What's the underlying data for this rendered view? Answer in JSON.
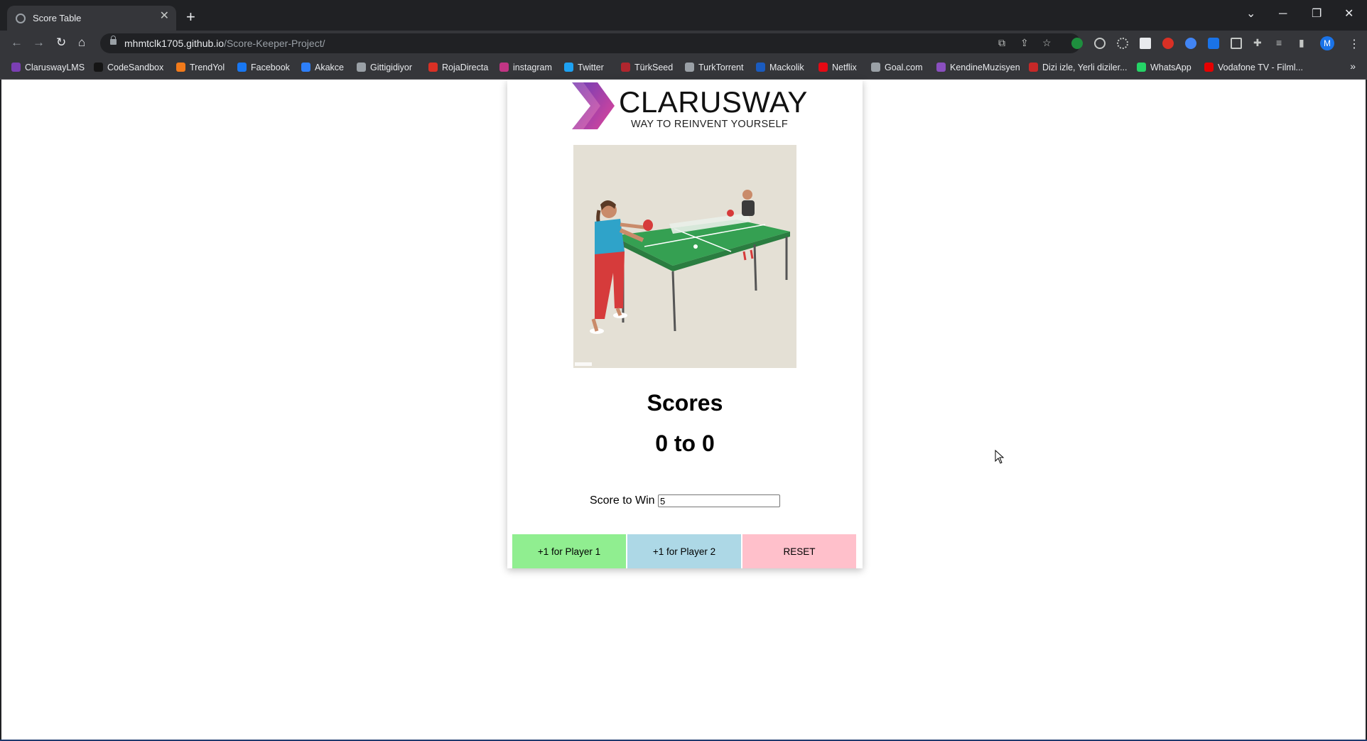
{
  "browser": {
    "tab_title": "Score Table",
    "url_host": "mhmtclk1705.github.io",
    "url_path": "/Score-Keeper-Project/",
    "profile_initial": "M"
  },
  "bookmarks": [
    {
      "label": "ClaruswayLMS",
      "color": "#7b3fb3"
    },
    {
      "label": "CodeSandbox",
      "color": "#151515"
    },
    {
      "label": "TrendYol",
      "color": "#f27a1a"
    },
    {
      "label": "Facebook",
      "color": "#1877f2"
    },
    {
      "label": "Akakce",
      "color": "#2d7ff9"
    },
    {
      "label": "Gittigidiyor",
      "color": "#9aa0a6"
    },
    {
      "label": "RojaDirecta",
      "color": "#d93025"
    },
    {
      "label": "instagram",
      "color": "#c13584"
    },
    {
      "label": "Twitter",
      "color": "#1da1f2"
    },
    {
      "label": "TürkSeed",
      "color": "#b0262e"
    },
    {
      "label": "TurkTorrent",
      "color": "#9aa0a6"
    },
    {
      "label": "Mackolik",
      "color": "#1a5bbf"
    },
    {
      "label": "Netflix",
      "color": "#e50914"
    },
    {
      "label": "Goal.com",
      "color": "#9aa0a6"
    },
    {
      "label": "KendineMuzisyen",
      "color": "#8a4fbf"
    },
    {
      "label": "Dizi izle, Yerli diziler...",
      "color": "#c62828"
    },
    {
      "label": "WhatsApp",
      "color": "#25d366"
    },
    {
      "label": "Vodafone TV - Filml...",
      "color": "#e60000"
    }
  ],
  "logo": {
    "title": "CLARUSWAY",
    "tagline": "WAY TO REINVENT YOURSELF",
    "gradient_start": "#7b3fb3",
    "gradient_end": "#e0459a"
  },
  "score": {
    "heading": "Scores",
    "player1": "0",
    "separator": "to",
    "player2": "0",
    "win_label": "Score to Win",
    "win_value": "5"
  },
  "buttons": {
    "player1": "+1 for Player 1",
    "player2": "+1 for Player 2",
    "reset": "RESET"
  },
  "colors": {
    "player1_button": "#90ee90",
    "player2_button": "#add8e6",
    "reset_button": "#ffc0cb"
  }
}
